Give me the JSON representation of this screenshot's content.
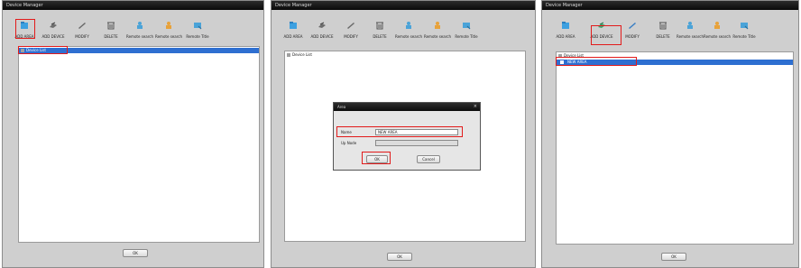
{
  "windows": [
    {
      "title": "Device Manager",
      "toolbar": [
        "ADD AREA",
        "ADD DEVICE",
        "MODIFY",
        "DELETE",
        "Remote search",
        "Remote search",
        "Remote Title"
      ],
      "tree_items": [
        "Device List"
      ],
      "ok_label": "OK"
    },
    {
      "title": "Device Manager",
      "toolbar": [
        "ADD AREA",
        "ADD DEVICE",
        "MODIFY",
        "DELETE",
        "Remote search",
        "Remote search",
        "Remote Title"
      ],
      "tree_items": [
        "Device List"
      ],
      "ok_label": "OK",
      "dialog": {
        "title": "Area",
        "name_label": "Name",
        "name_value": "NEW AREA",
        "up_node_label": "Up Node",
        "up_node_value": "",
        "ok_label": "OK",
        "cancel_label": "Cancel",
        "close_glyph": "×"
      }
    },
    {
      "title": "Device Manager",
      "toolbar": [
        "ADD AREA",
        "ADD DEVICE",
        "MODIFY",
        "DELETE",
        "Remote search",
        "Remote search",
        "Remote Title"
      ],
      "tree_items": [
        "Device List",
        "NEW AREA"
      ],
      "ok_label": "OK"
    }
  ],
  "colors": {
    "highlight": "#e21b1b",
    "selection": "#2e6fd1",
    "titlebar": "#0a0a0a"
  },
  "icons": [
    "add-area-icon",
    "add-device-icon",
    "modify-icon",
    "delete-icon",
    "remote-search-icon",
    "remote-search-icon",
    "remote-title-icon"
  ]
}
